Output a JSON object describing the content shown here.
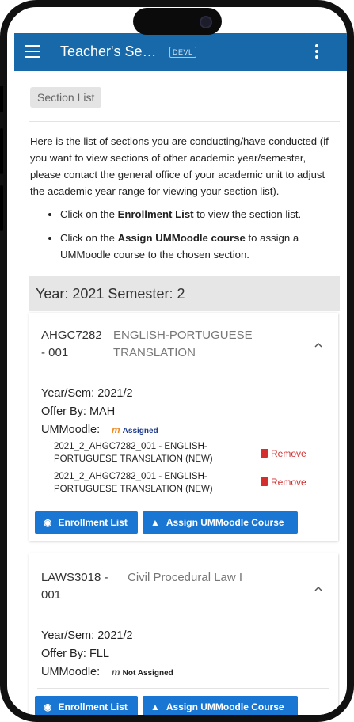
{
  "appbar": {
    "title": "Teacher's Se…",
    "env_badge": "DEVL"
  },
  "section_chip": "Section List",
  "intro_text": "Here is the list of sections you are conducting/have conducted (if you want to view sections of other academic year/semester, please contact the general office of your academic unit to adjust the academic year range for viewing your section list).",
  "bullets": [
    {
      "prefix": "Click on the ",
      "bold": "Enrollment List",
      "suffix": " to view the section list."
    },
    {
      "prefix": "Click on the ",
      "bold": "Assign UMMoodle course",
      "suffix": " to assign a UMMoodle course to the chosen section."
    }
  ],
  "year_header": "Year: 2021 Semester: 2",
  "cards": [
    {
      "code": "AHGC7282 - 001",
      "name": "ENGLISH-PORTUGUESE TRANSLATION",
      "year_sem": "Year/Sem: 2021/2",
      "offer_by": "Offer By: MAH",
      "ummoodle_label": "UMMoodle:",
      "ummoodle_status": "Assigned",
      "moodle_courses": [
        {
          "name": "2021_2_AHGC7282_001 - ENGLISH-PORTUGUESE TRANSLATION (NEW)",
          "remove": "Remove"
        },
        {
          "name": "2021_2_AHGC7282_001 - ENGLISH-PORTUGUESE TRANSLATION (NEW)",
          "remove": "Remove"
        }
      ],
      "enroll_label": "Enrollment List",
      "assign_label": "Assign UMMoodle Course"
    },
    {
      "code": "LAWS3018 - 001",
      "name": "Civil Procedural Law I",
      "year_sem": "Year/Sem: 2021/2",
      "offer_by": "Offer By: FLL",
      "ummoodle_label": "UMMoodle:",
      "ummoodle_status": "Not Assigned",
      "enroll_label": "Enrollment List",
      "assign_label": "Assign UMMoodle Course"
    }
  ],
  "colors": {
    "appbar": "#1769aa",
    "button": "#1976d2",
    "remove": "#d32f2f",
    "moodle_orange": "#f08a24"
  },
  "icons": {
    "menu": "hamburger-icon",
    "more": "more-vert-icon",
    "expand": "chevron-up-icon",
    "enrollment": "people-icon",
    "assign": "graduation-cap-icon",
    "remove": "trash-icon",
    "moodle": "moodle-m-icon"
  }
}
